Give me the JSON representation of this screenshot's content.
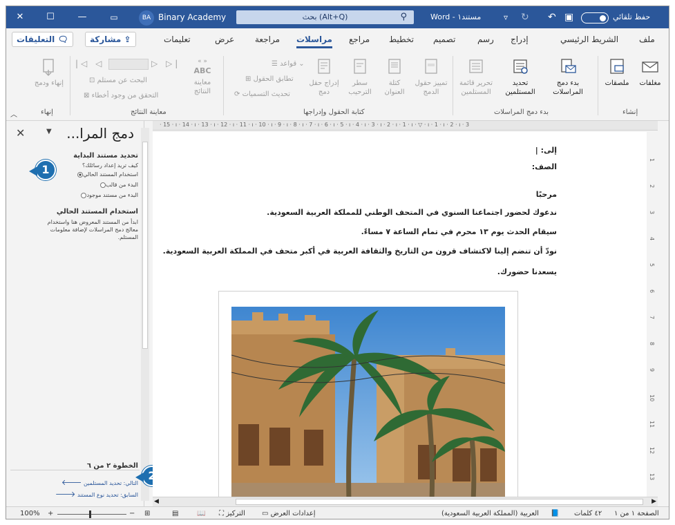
{
  "titlebar": {
    "autosave": "حفظ تلقائي",
    "doc_name": "مستند١ - Word",
    "search_placeholder": "بحث (Alt+Q)",
    "user_initials": "BA",
    "user_name": "Binary Academy"
  },
  "tabs": {
    "items": [
      "ملف",
      "الشريط الرئيسي",
      "إدراج",
      "رسم",
      "تصميم",
      "تخطيط",
      "مراجع",
      "مراسلات",
      "مراجعة",
      "عرض",
      "تعليمات"
    ],
    "active": "مراسلات",
    "share": "مشاركة",
    "comments": "التعليقات"
  },
  "ribbon": {
    "group_create": {
      "label": "إنشاء",
      "envelopes": "مغلفات",
      "labels": "ملصقات"
    },
    "group_start": {
      "label": "بدء دمج المراسلات",
      "start_merge": "بدء دمج المراسلات",
      "select_recipients": "تحديد المستلمين",
      "edit_list": "تحرير قائمة المستلمين"
    },
    "group_fields": {
      "label": "كتابة الحقول وإدراجها",
      "highlight": "تمييز حقول الدمج",
      "address_block": "كتلة العنوان",
      "greeting": "سطر الترحيب",
      "insert_field": "إدراج حقل دمج",
      "rules": "قواعد",
      "match_fields": "تطابق الحقول",
      "update_labels": "تحديث التسميات"
    },
    "group_preview": {
      "label": "معاينة النتائج",
      "preview": "معاينة النتائج",
      "abc": "ABC",
      "find_recipient": "البحث عن مستلم",
      "check_errors": "التحقق من وجود أخطاء"
    },
    "group_finish": {
      "label": "إنهاء",
      "finish": "إنهاء ودمج"
    }
  },
  "pane": {
    "title": "دمج المرا...",
    "section1": "تحديد مستند البداية",
    "question": "كيف تريد إعداد رسائلك؟",
    "options": [
      "استخدام المستند الحالي",
      "البدء من قالب",
      "البدء من مستند موجود"
    ],
    "selected": 0,
    "section2": "استخدام المستند الحالي",
    "desc": [
      "ابدأ من المستند المعروض هنا واستخدام",
      "معالج دمج المراسلات لإضافة معلومات",
      "المستلم."
    ],
    "step": "الخطوة ٢ من ٦",
    "next": "التالي: تحديد المستلمين",
    "prev": "السابق: تحديد نوع المستند",
    "callouts": [
      "1",
      "2"
    ]
  },
  "ruler": {
    "marks": "· 15 · ı · 14 · ı · 13 · ı · 12 · ı · 11 · ı · 10 · ı · 9 · ı · 8 · ı · 7 · ı · 6 · ı · 5 · ı · 4 · ı · 3 · ı · 2 · ı · 1 · ı · ▽ · ı · 1 · ı · 2 · ı · 3"
  },
  "vruler": {
    "marks": [
      "1",
      "2",
      "3",
      "4",
      "5",
      "6",
      "7",
      "8",
      "9",
      "10",
      "11",
      "12",
      "13"
    ]
  },
  "document": {
    "lines": [
      "إلى: |",
      "الصف:",
      "مرحبًا",
      "ندعوك لحضور اجتماعنا السنوي في المتحف الوطني للمملكة العربية السعودية.",
      "سيقام الحدث يوم ١٣ محرم في تمام الساعة ٧ مساءً.",
      "نودّ أن تنضم إلينا لاكتشاف قرون من التاريخ والثقافة العربية في أكبر متحف في المملكة العربية السعودية.",
      "يسعدنا حضورك."
    ]
  },
  "status": {
    "page": "الصفحة ١ من ١",
    "words": "٤٢ كلمات",
    "language": "العربية (المملكة العربية السعودية)",
    "display_settings": "إعدادات العرض",
    "focus": "التركيز",
    "zoom": "100%"
  },
  "colors": {
    "brand": "#2b579a",
    "callout": "#1e6fb0"
  }
}
